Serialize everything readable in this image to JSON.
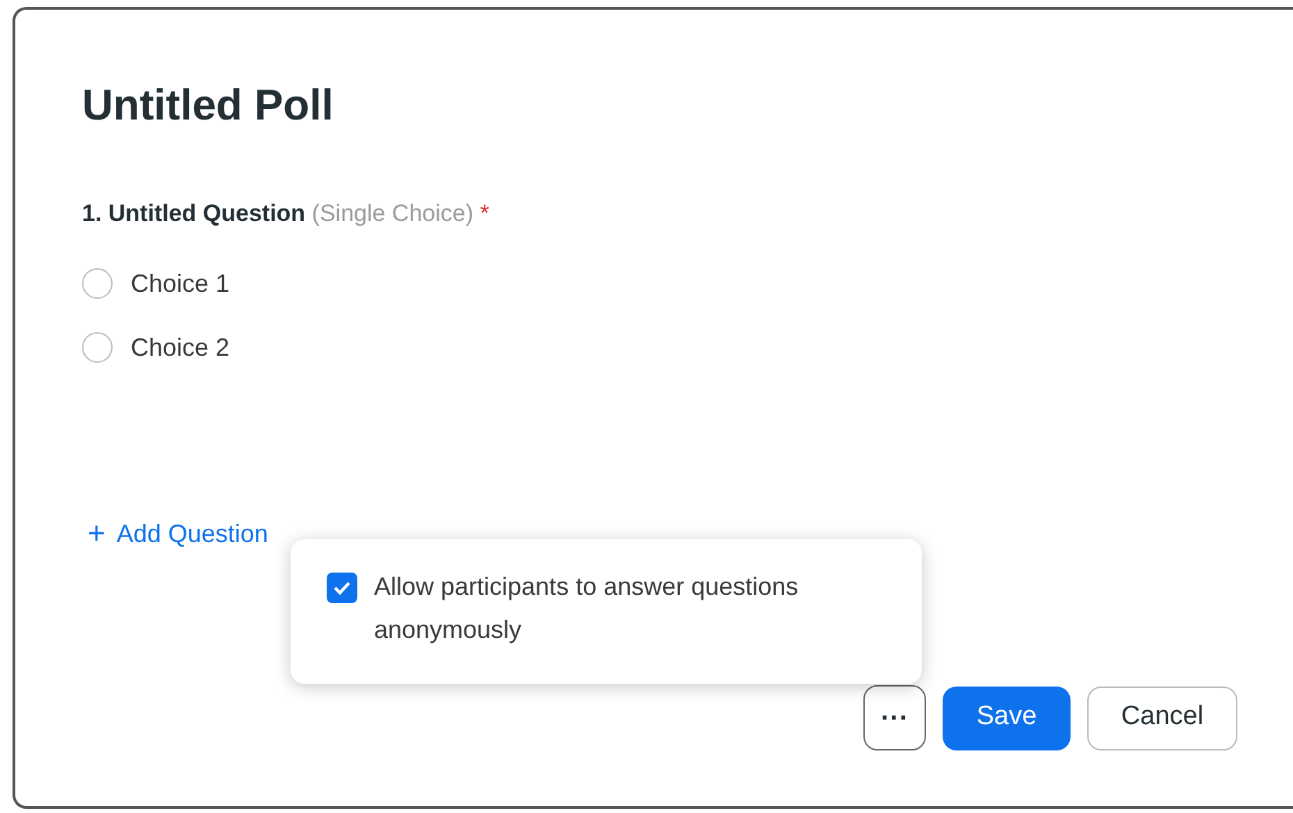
{
  "poll": {
    "title": "Untitled Poll"
  },
  "question": {
    "number": "1.",
    "title": "Untitled Question",
    "type": "(Single Choice)",
    "required_mark": "*"
  },
  "choices": [
    {
      "label": "Choice 1",
      "selected": false
    },
    {
      "label": "Choice 2",
      "selected": false
    }
  ],
  "add_question": {
    "icon": "+",
    "label": "Add Question"
  },
  "popover": {
    "option": {
      "label": "Allow participants to answer questions anonymously",
      "checked": true
    }
  },
  "footer": {
    "more": "···",
    "buttons": [
      {
        "label": "Save",
        "kind": "primary"
      },
      {
        "label": "Cancel",
        "kind": "secondary"
      }
    ]
  }
}
